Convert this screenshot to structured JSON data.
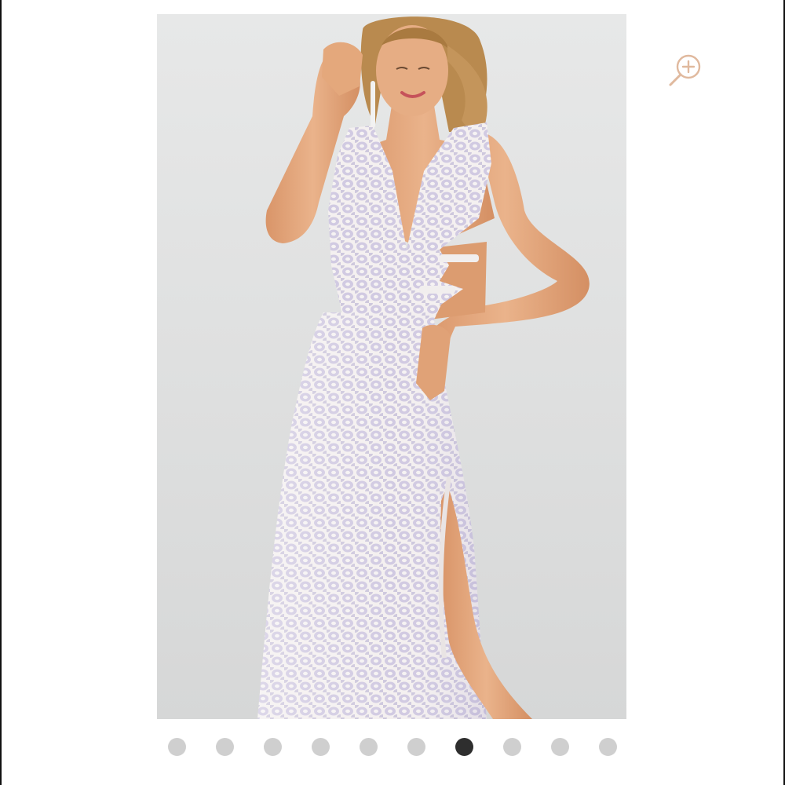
{
  "colors": {
    "zoom_icon": "#e0b99e",
    "dot_inactive": "#cfcfcf",
    "dot_active": "#2e2e2e",
    "backdrop": "#e3e4e4",
    "dress_base": "#f4f0f0",
    "dress_pattern": "#a59cc8",
    "skin": "#e0a277",
    "hair": "#b98a4f"
  },
  "gallery": {
    "total_images": 10,
    "active_index": 6
  },
  "zoom": {
    "icon": "zoom-in-icon"
  }
}
